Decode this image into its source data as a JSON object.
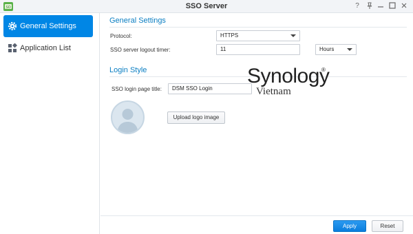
{
  "window": {
    "title": "SSO Server",
    "controls": [
      "help-icon",
      "pin-icon",
      "minimize-icon",
      "maximize-icon",
      "close-icon"
    ]
  },
  "sidebar": {
    "items": [
      {
        "label": "General Settings",
        "icon": "gear-icon",
        "active": true
      },
      {
        "label": "Application List",
        "icon": "apps-grid-icon",
        "active": false
      }
    ]
  },
  "general": {
    "title": "General Settings",
    "protocol_label": "Protocol:",
    "protocol_value": "HTTPS",
    "timer_label": "SSO server logout timer:",
    "timer_value": "11",
    "timer_unit": "Hours"
  },
  "login_style": {
    "title": "Login Style",
    "page_title_label": "SSO login page title:",
    "page_title_value": "DSM SSO Login",
    "upload_label": "Upload logo image"
  },
  "watermark": {
    "brand": "Synology",
    "registered": "®",
    "sub": "Vietnam"
  },
  "footer": {
    "apply_label": "Apply",
    "reset_label": "Reset"
  },
  "colors": {
    "accent": "#0086e5",
    "section_title": "#0a7ec2"
  }
}
